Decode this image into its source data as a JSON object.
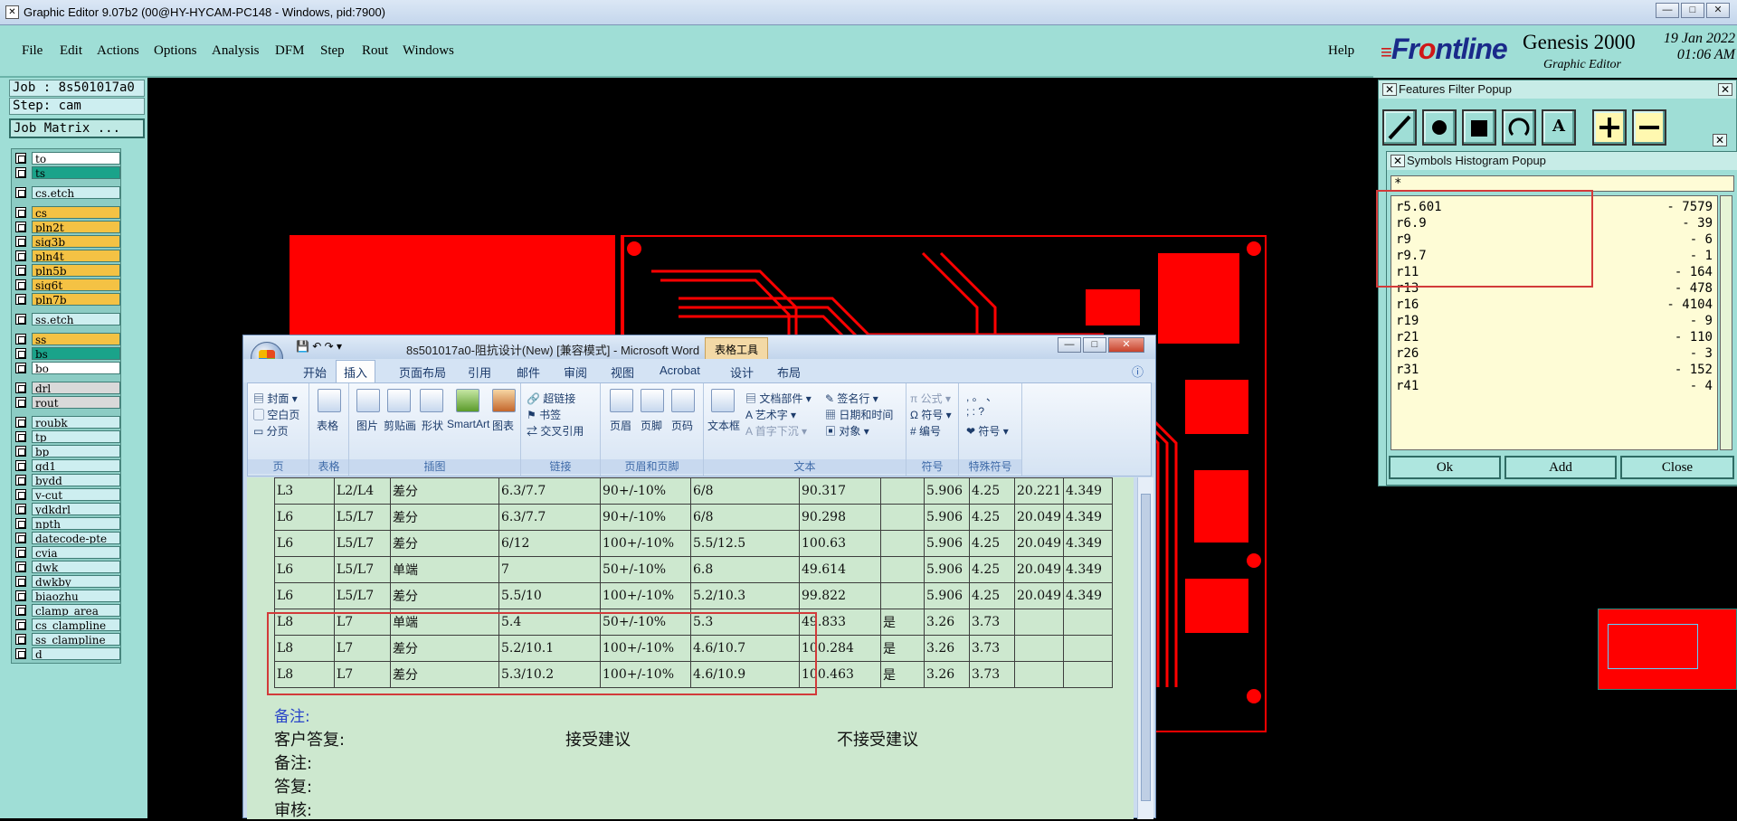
{
  "window": {
    "title": "Graphic Editor 9.07b2 (00@HY-HYCAM-PC148 - Windows, pid:7900)",
    "min": "—",
    "max": "□",
    "close": "✕"
  },
  "menu": [
    "File",
    "Edit",
    "Actions",
    "Options",
    "Analysis",
    "DFM",
    "Step",
    "Rout",
    "Windows"
  ],
  "help": "Help",
  "brand": {
    "logo_pre": "Fr",
    "logo_o": "o",
    "logo_post": "ntline",
    "product": "Genesis 2000",
    "subtitle": "Graphic Editor",
    "date": "19 Jan 2022",
    "time": "01:06 AM"
  },
  "job": {
    "job_label": "Job : 8s501017a0",
    "step_label": "Step: cam",
    "matrix_button": "Job Matrix ..."
  },
  "layers": [
    {
      "name": "to",
      "color": "#ffffff"
    },
    {
      "name": "ts",
      "color": "#1aa38a"
    },
    {
      "name": "cs.etch",
      "color": "#cdeef0"
    },
    {
      "name": "cs",
      "color": "#f4c244"
    },
    {
      "name": "pln2t",
      "color": "#f4c244"
    },
    {
      "name": "sig3b",
      "color": "#f4c244"
    },
    {
      "name": "pln4t",
      "color": "#f4c244"
    },
    {
      "name": "pln5b",
      "color": "#f4c244"
    },
    {
      "name": "sig6t",
      "color": "#f4c244"
    },
    {
      "name": "pln7b",
      "color": "#f4c244"
    },
    {
      "name": "ss.etch",
      "color": "#cdeef0"
    },
    {
      "name": "ss",
      "color": "#f4c244"
    },
    {
      "name": "bs",
      "color": "#1aa38a"
    },
    {
      "name": "bo",
      "color": "#ffffff"
    },
    {
      "name": "drl",
      "color": "#d9d9d9"
    },
    {
      "name": "rout",
      "color": "#d9d9d9"
    },
    {
      "name": "roubk",
      "color": "#cdeef0"
    },
    {
      "name": "tp",
      "color": "#cdeef0"
    },
    {
      "name": "bp",
      "color": "#cdeef0"
    },
    {
      "name": "gd1",
      "color": "#cdeef0"
    },
    {
      "name": "bydd",
      "color": "#cdeef0"
    },
    {
      "name": "v-cut",
      "color": "#cdeef0"
    },
    {
      "name": "ydkdrl",
      "color": "#cdeef0"
    },
    {
      "name": "npth",
      "color": "#cdeef0"
    },
    {
      "name": "datecode-pte",
      "color": "#cdeef0"
    },
    {
      "name": "cvia",
      "color": "#cdeef0"
    },
    {
      "name": "dwk",
      "color": "#cdeef0"
    },
    {
      "name": "dwkby",
      "color": "#cdeef0"
    },
    {
      "name": "biaozhu",
      "color": "#cdeef0"
    },
    {
      "name": "clamp_area",
      "color": "#cdeef0"
    },
    {
      "name": "cs_clampline",
      "color": "#cdeef0"
    },
    {
      "name": "ss_clampline",
      "color": "#cdeef0"
    },
    {
      "name": "d",
      "color": "#cdeef0"
    }
  ],
  "word": {
    "title": "8s501017a0-阻抗设计(New) [兼容模式] - Microsoft Word",
    "tools": "表格工具",
    "tabs": [
      "开始",
      "插入",
      "页面布局",
      "引用",
      "邮件",
      "审阅",
      "视图",
      "Acrobat",
      "设计",
      "布局"
    ],
    "active_tab": "插入",
    "groups": {
      "page": {
        "label": "页",
        "items": [
          "封面",
          "空白页",
          "分页"
        ]
      },
      "table": {
        "label": "表格",
        "items": [
          "表格"
        ]
      },
      "illus": {
        "label": "插图",
        "items": [
          "图片",
          "剪贴画",
          "形状",
          "SmartArt",
          "图表"
        ]
      },
      "links": {
        "label": "链接",
        "items": [
          "超链接",
          "书签",
          "交叉引用"
        ]
      },
      "hf": {
        "label": "页眉和页脚",
        "items": [
          "页眉",
          "页脚",
          "页码"
        ]
      },
      "text": {
        "label": "文本",
        "items": [
          "文本框",
          "文档部件",
          "艺术字",
          "首字下沉",
          "签名行",
          "日期和时间",
          "对象"
        ]
      },
      "sym": {
        "label": "符号",
        "items": [
          "公式",
          "符号",
          "编号"
        ]
      },
      "special": {
        "label": "特殊符号",
        "items": [
          "符号"
        ]
      }
    },
    "table_rows": [
      [
        "L3",
        "L2/L4",
        "差分",
        "6.3/7.7",
        "90+/-10%",
        "6/8",
        "90.317",
        "",
        "5.906",
        "4.25",
        "20.221",
        "4.349"
      ],
      [
        "L6",
        "L5/L7",
        "差分",
        "6.3/7.7",
        "90+/-10%",
        "6/8",
        "90.298",
        "",
        "5.906",
        "4.25",
        "20.049",
        "4.349"
      ],
      [
        "L6",
        "L5/L7",
        "差分",
        "6/12",
        "100+/-10%",
        "5.5/12.5",
        "100.63",
        "",
        "5.906",
        "4.25",
        "20.049",
        "4.349"
      ],
      [
        "L6",
        "L5/L7",
        "单端",
        "7",
        "50+/-10%",
        "6.8",
        "49.614",
        "",
        "5.906",
        "4.25",
        "20.049",
        "4.349"
      ],
      [
        "L6",
        "L5/L7",
        "差分",
        "5.5/10",
        "100+/-10%",
        "5.2/10.3",
        "99.822",
        "",
        "5.906",
        "4.25",
        "20.049",
        "4.349"
      ],
      [
        "L8",
        "L7",
        "单端",
        "5.4",
        "50+/-10%",
        "5.3",
        "49.833",
        "是",
        "3.26",
        "3.73",
        "",
        ""
      ],
      [
        "L8",
        "L7",
        "差分",
        "5.2/10.1",
        "100+/-10%",
        "4.6/10.7",
        "100.284",
        "是",
        "3.26",
        "3.73",
        "",
        ""
      ],
      [
        "L8",
        "L7",
        "差分",
        "5.3/10.2",
        "100+/-10%",
        "4.6/10.9",
        "100.463",
        "是",
        "3.26",
        "3.73",
        "",
        ""
      ]
    ],
    "notes": {
      "remark_blue": "备注:",
      "reply": "客户答复:",
      "accept": "接受建议",
      "reject": "不接受建议",
      "remark": "备注:",
      "answer": "答复:",
      "review": "审核:"
    }
  },
  "features_popup": {
    "title": "Features Filter Popup",
    "close": "✕"
  },
  "histogram": {
    "title": "Symbols Histogram Popup",
    "close": "✕",
    "filter": "*",
    "rows": [
      {
        "sym": "r5.601",
        "count": "- 7579"
      },
      {
        "sym": "r6.9",
        "count": "- 39"
      },
      {
        "sym": "r9",
        "count": "- 6"
      },
      {
        "sym": "r9.7",
        "count": "- 1"
      },
      {
        "sym": "r11",
        "count": "- 164"
      },
      {
        "sym": "r13",
        "count": "- 478"
      },
      {
        "sym": "r16",
        "count": "- 4104"
      },
      {
        "sym": "r19",
        "count": "- 9"
      },
      {
        "sym": "r21",
        "count": "- 110"
      },
      {
        "sym": "r26",
        "count": "- 3"
      },
      {
        "sym": "r31",
        "count": "- 152"
      },
      {
        "sym": "r41",
        "count": "- 4"
      }
    ],
    "ok": "Ok",
    "add": "Add",
    "close_btn": "Close"
  }
}
